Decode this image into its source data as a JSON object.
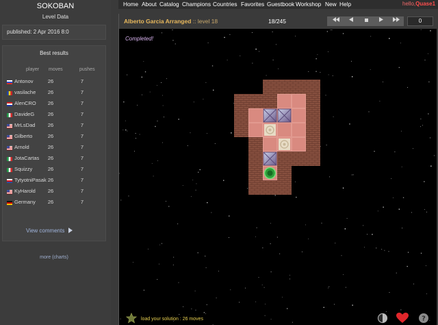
{
  "sidebar": {
    "logo": "SOKOBAN",
    "level_data_title": "Level Data",
    "published": "published: 2 Apr 2016 8:0",
    "best_results_title": "Best results",
    "col_player": "player",
    "col_moves": "moves",
    "col_pushes": "pushes",
    "results": [
      {
        "flag": "russia",
        "player": "Antonov",
        "moves": "26",
        "pushes": "7"
      },
      {
        "flag": "romania",
        "player": "vasilache",
        "moves": "26",
        "pushes": "7"
      },
      {
        "flag": "croatia",
        "player": "AlenCRO",
        "moves": "26",
        "pushes": "7"
      },
      {
        "flag": "italy",
        "player": "DavideG",
        "moves": "26",
        "pushes": "7"
      },
      {
        "flag": "usa",
        "player": "MrLsDad",
        "moves": "26",
        "pushes": "7"
      },
      {
        "flag": "usa",
        "player": "Gilberto",
        "moves": "26",
        "pushes": "7"
      },
      {
        "flag": "usa",
        "player": "Arnold",
        "moves": "26",
        "pushes": "7"
      },
      {
        "flag": "italy",
        "player": "JotaCartas",
        "moves": "26",
        "pushes": "7"
      },
      {
        "flag": "italy",
        "player": "Squizzy",
        "moves": "26",
        "pushes": "7"
      },
      {
        "flag": "czech",
        "player": "TytyotniPasak",
        "moves": "26",
        "pushes": "7"
      },
      {
        "flag": "usa",
        "player": "KyHarold",
        "moves": "26",
        "pushes": "7"
      },
      {
        "flag": "germany",
        "player": "Germany",
        "moves": "26",
        "pushes": "7"
      }
    ],
    "more_label": "more",
    "charts_label": "(charts)",
    "view_comments": "View comments"
  },
  "nav": {
    "items": [
      "Home",
      "About",
      "Catalog",
      "Champions",
      "Countries",
      "Favorites",
      "Guestbook",
      "Workshop",
      "New",
      "Help"
    ],
    "hello_prefix": "hello,",
    "username": "Quase1"
  },
  "game": {
    "level_name": "Alberto Garcia Arranged",
    "level_suffix": ":: level 18",
    "counter": "18/245",
    "moves_count": "0",
    "status": "Completed!",
    "load_solution": "load your solution : 26 moves",
    "board": {
      "rows": [
        "  WWWW",
        "WWWFFW",
        "WFBBFW",
        "WFGFFW",
        " WFGFW",
        " WBWWW",
        " WPW  ",
        " WWW  "
      ],
      "legend": {
        "W": "wall",
        "F": "floor",
        "B": "box-on-goal",
        "G": "goal",
        "P": "player"
      }
    }
  },
  "colors": {
    "accent_orange": "#e8b85c",
    "completed_purple": "#d9b3f0",
    "hello_red": "#ff4d4d",
    "wall_brown": "#8b5444",
    "floor_salmon": "#d98a80"
  },
  "icons": {
    "controls": [
      "first-icon",
      "prev-icon",
      "stop-icon",
      "next-icon",
      "last-icon"
    ],
    "footer": [
      "star-icon",
      "contrast-icon",
      "heart-icon",
      "help-icon"
    ]
  }
}
